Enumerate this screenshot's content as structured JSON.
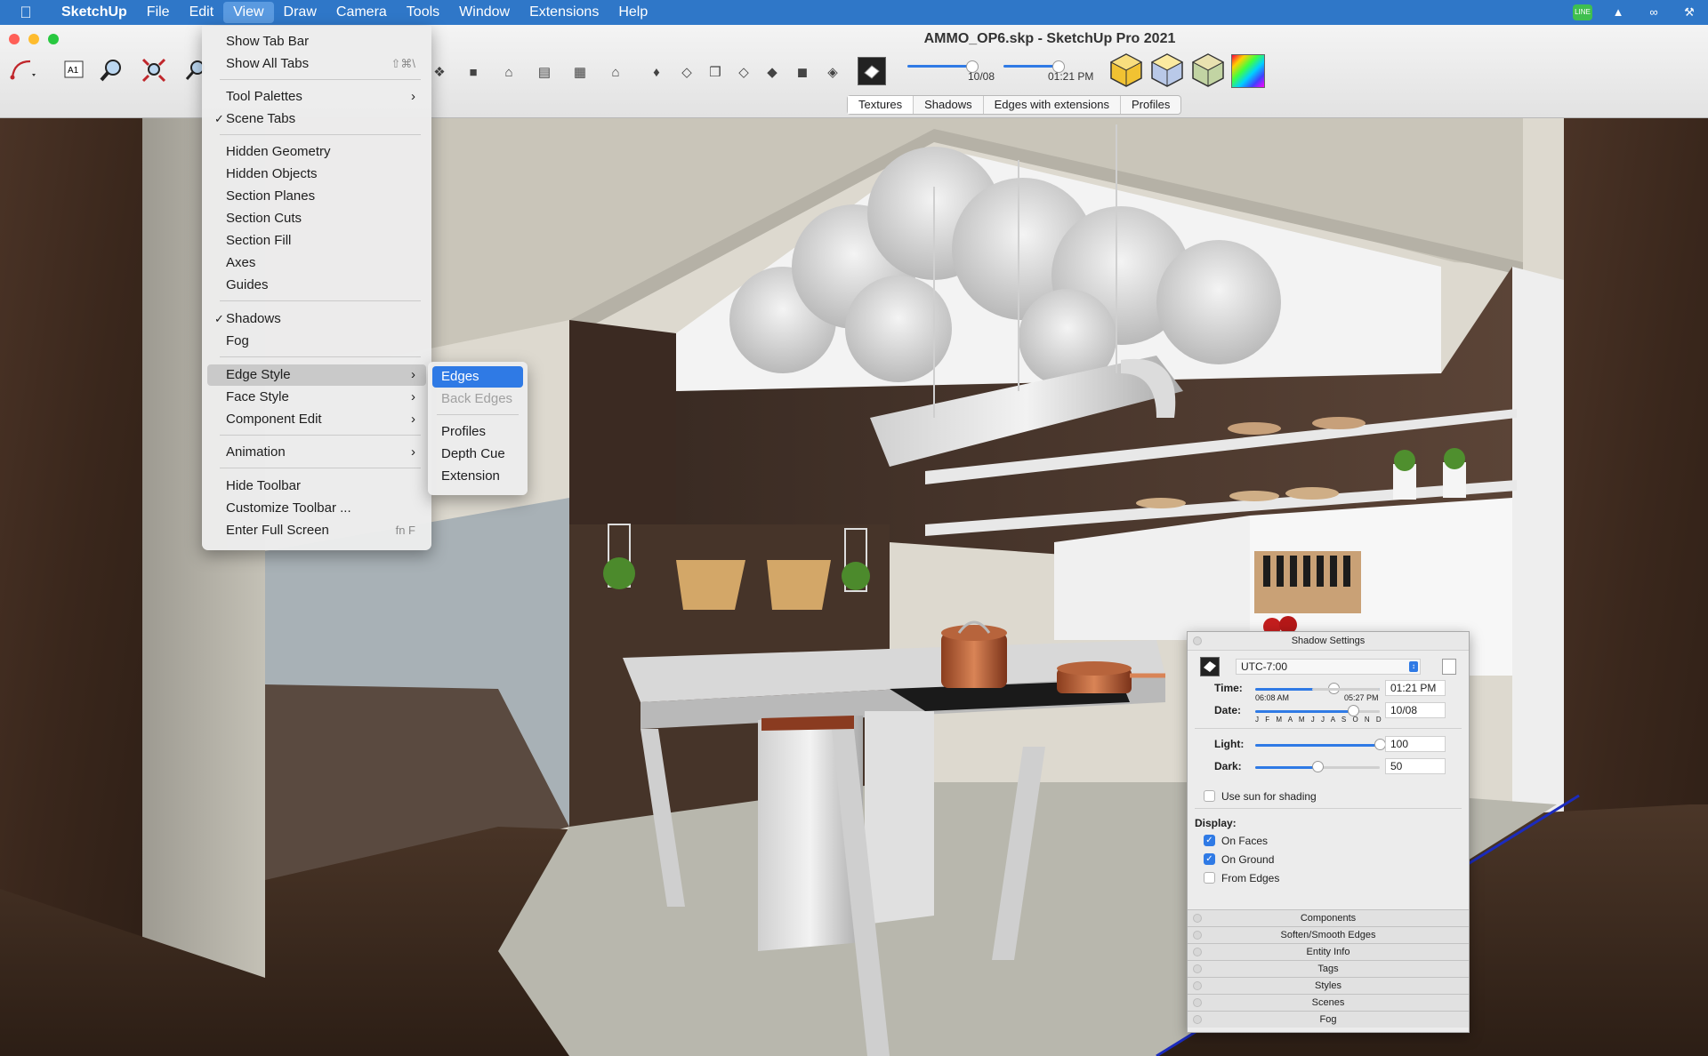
{
  "menubar": {
    "app": "SketchUp",
    "items": [
      "File",
      "Edit",
      "View",
      "Draw",
      "Camera",
      "Tools",
      "Window",
      "Extensions",
      "Help"
    ],
    "active": "View"
  },
  "window": {
    "title": "AMMO_OP6.skp - SketchUp Pro 2021"
  },
  "toolbar": {
    "time_value": "01:21 PM",
    "date_value": "10/08"
  },
  "scene_tabs": [
    "Textures",
    "Shadows",
    "Edges with extensions",
    "Profiles"
  ],
  "view_menu": {
    "show_tab_bar": "Show Tab Bar",
    "show_all_tabs": "Show All Tabs",
    "show_all_tabs_shortcut": "⇧⌘\\",
    "tool_palettes": "Tool Palettes",
    "scene_tabs": "Scene Tabs",
    "hidden_geometry": "Hidden Geometry",
    "hidden_objects": "Hidden Objects",
    "section_planes": "Section Planes",
    "section_cuts": "Section Cuts",
    "section_fill": "Section Fill",
    "axes": "Axes",
    "guides": "Guides",
    "shadows": "Shadows",
    "fog": "Fog",
    "edge_style": "Edge Style",
    "face_style": "Face Style",
    "component_edit": "Component Edit",
    "animation": "Animation",
    "hide_toolbar": "Hide Toolbar",
    "customize_toolbar": "Customize Toolbar ...",
    "enter_full_screen": "Enter Full Screen",
    "enter_full_screen_shortcut": "fn F"
  },
  "edge_submenu": {
    "edges": "Edges",
    "back_edges": "Back Edges",
    "profiles": "Profiles",
    "depth_cue": "Depth Cue",
    "extension": "Extension"
  },
  "shadow_settings": {
    "title": "Shadow Settings",
    "timezone": "UTC-7:00",
    "time_label": "Time:",
    "time_start": "06:08 AM",
    "time_end": "05:27 PM",
    "time_value": "01:21 PM",
    "date_label": "Date:",
    "months": "J F M A M J J A S O N D",
    "date_value": "10/08",
    "light_label": "Light:",
    "light_value": "100",
    "dark_label": "Dark:",
    "dark_value": "50",
    "use_sun": "Use sun for shading",
    "display_label": "Display:",
    "on_faces": "On Faces",
    "on_ground": "On Ground",
    "from_edges": "From Edges",
    "accent": "#2f7ae5"
  },
  "trays": [
    "Components",
    "Soften/Smooth Edges",
    "Entity Info",
    "Tags",
    "Styles",
    "Scenes",
    "Fog"
  ]
}
